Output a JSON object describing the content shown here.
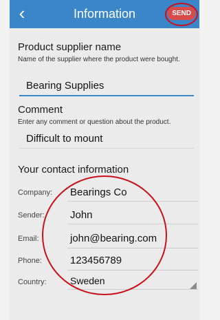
{
  "header": {
    "back_icon": "chevron-left-icon",
    "title": "Information",
    "send_label": "SEND"
  },
  "supplier": {
    "title": "Product supplier name",
    "description": "Name of the supplier where the product were bought.",
    "value": "Bearing Supplies"
  },
  "comment": {
    "title": "Comment",
    "description": "Enter any comment or question about the product.",
    "value": "Difficult to mount"
  },
  "contact": {
    "title": "Your contact information",
    "fields": [
      {
        "label": "Company:",
        "value": "Bearings Co"
      },
      {
        "label": "Sender:",
        "value": "John"
      },
      {
        "label": "Email:",
        "value": "john@bearing.com"
      },
      {
        "label": "Phone:",
        "value": "123456789"
      },
      {
        "label": "Country:",
        "value": "Sweden"
      }
    ]
  }
}
